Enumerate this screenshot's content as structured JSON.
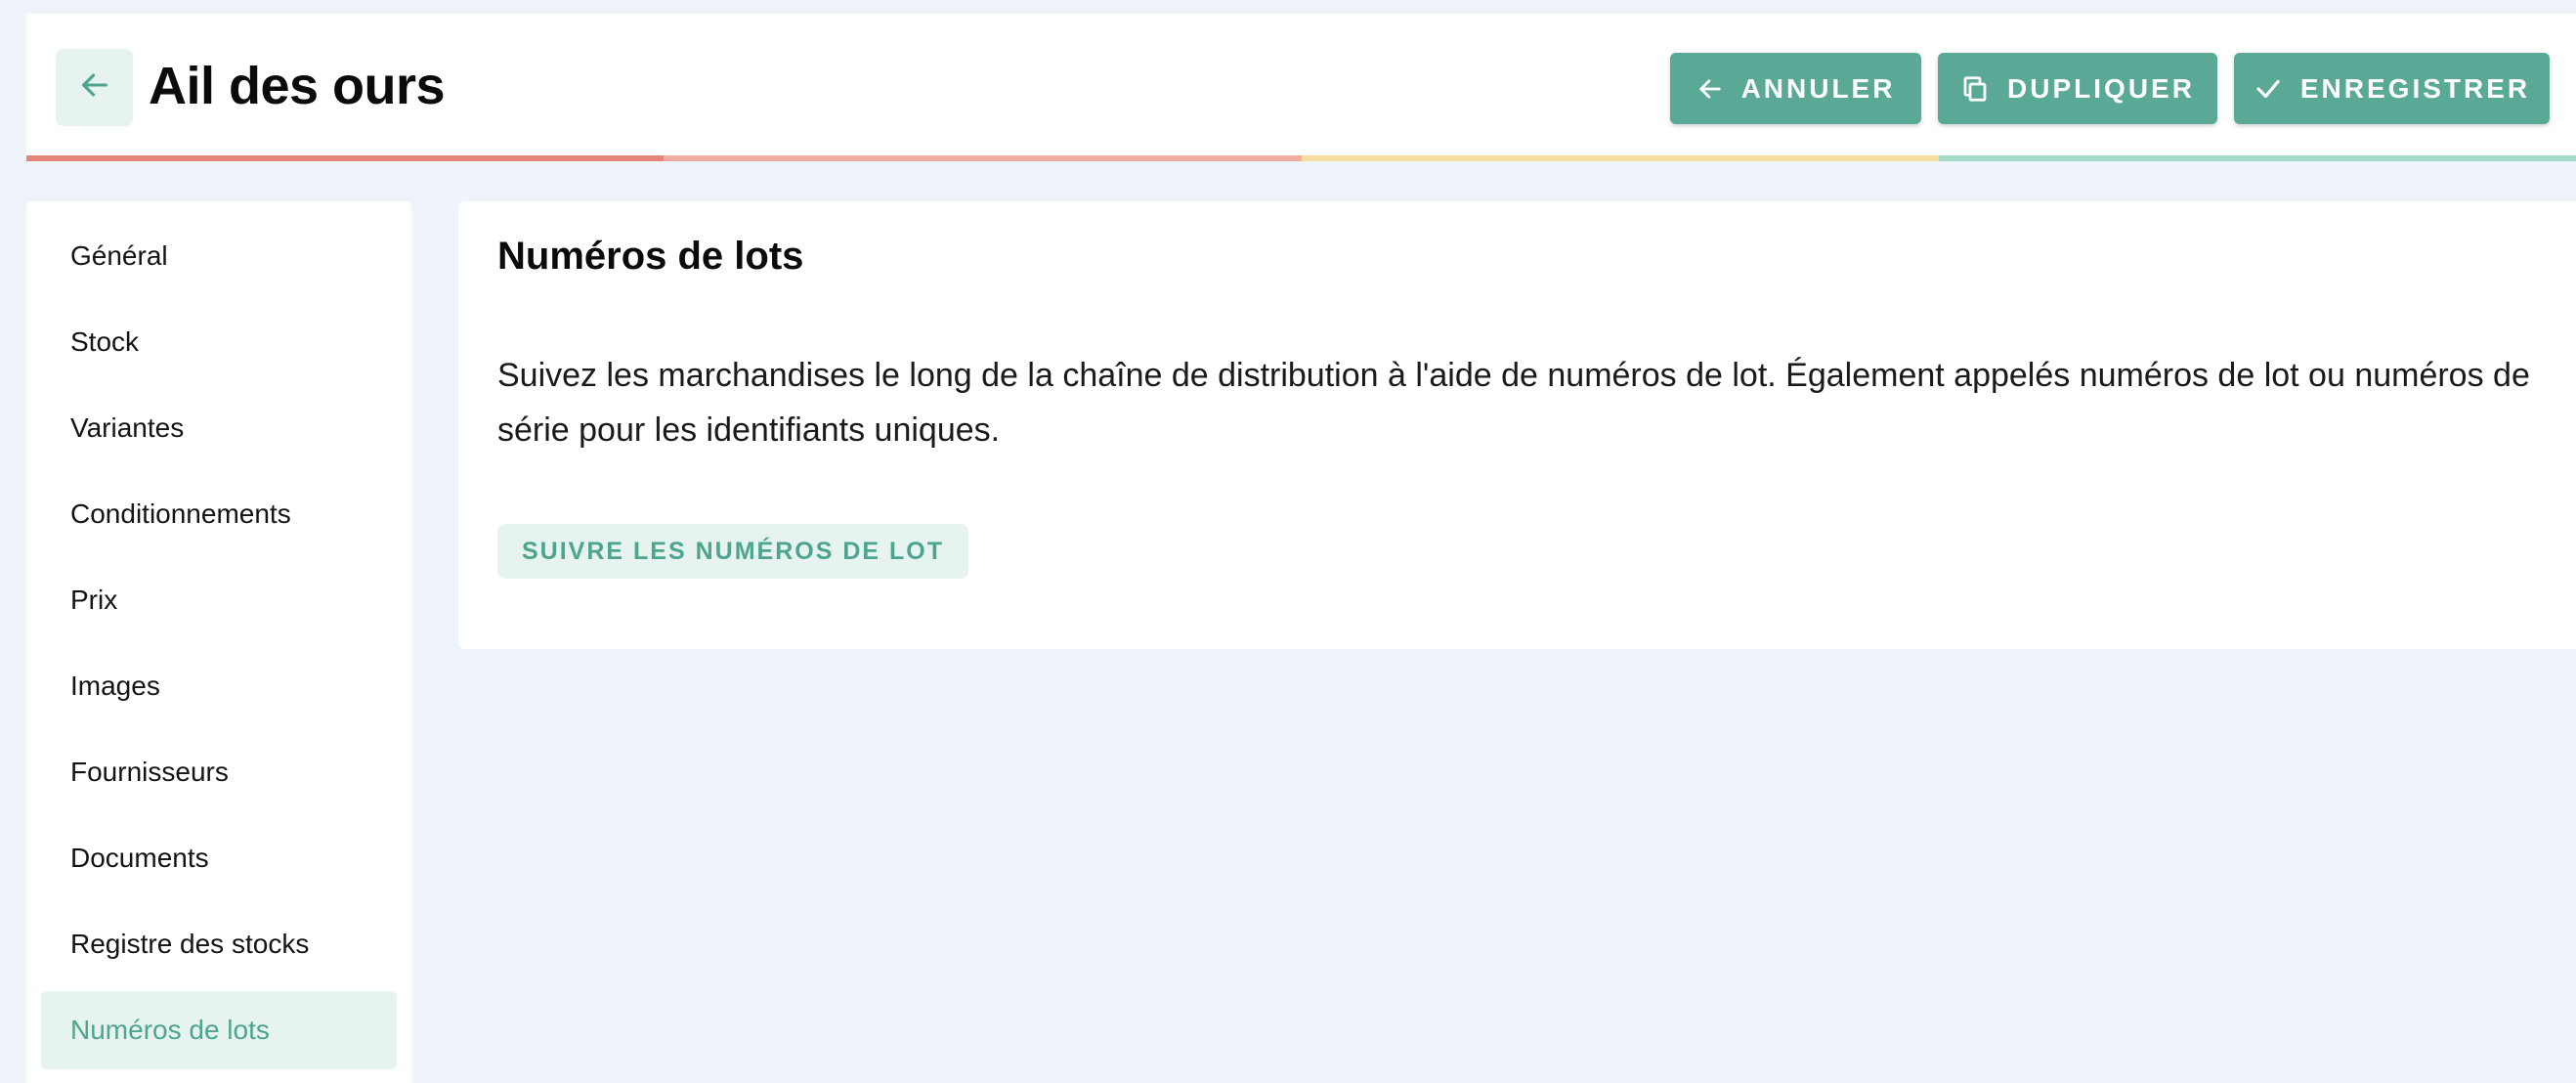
{
  "header": {
    "title": "Ail des ours",
    "back_icon": "arrow-left-icon",
    "actions": {
      "cancel_label": "ANNULER",
      "duplicate_label": "DUPLIQUER",
      "save_label": "ENREGISTRER"
    },
    "progress_colors": [
      "#e5857a",
      "#f2ada0",
      "#f7dca0",
      "#a6dacb"
    ]
  },
  "sidebar": {
    "items": [
      {
        "label": "Général"
      },
      {
        "label": "Stock"
      },
      {
        "label": "Variantes"
      },
      {
        "label": "Conditionnements"
      },
      {
        "label": "Prix"
      },
      {
        "label": "Images"
      },
      {
        "label": "Fournisseurs"
      },
      {
        "label": "Documents"
      },
      {
        "label": "Registre des stocks"
      },
      {
        "label": "Numéros de lots",
        "active": true
      }
    ]
  },
  "main": {
    "title": "Numéros de lots",
    "description": "Suivez les marchandises le long de la chaîne de distribution à l'aide de numéros de lot. Également appelés numéros de lot ou numéros de série pour les identifiants uniques.",
    "action_label": "SUIVRE LES NUMÉROS DE LOT"
  },
  "colors": {
    "accent": "#5aa996",
    "accent_light": "#e6f3ef",
    "accent_text": "#4ea58f",
    "background": "#eff4fb"
  }
}
